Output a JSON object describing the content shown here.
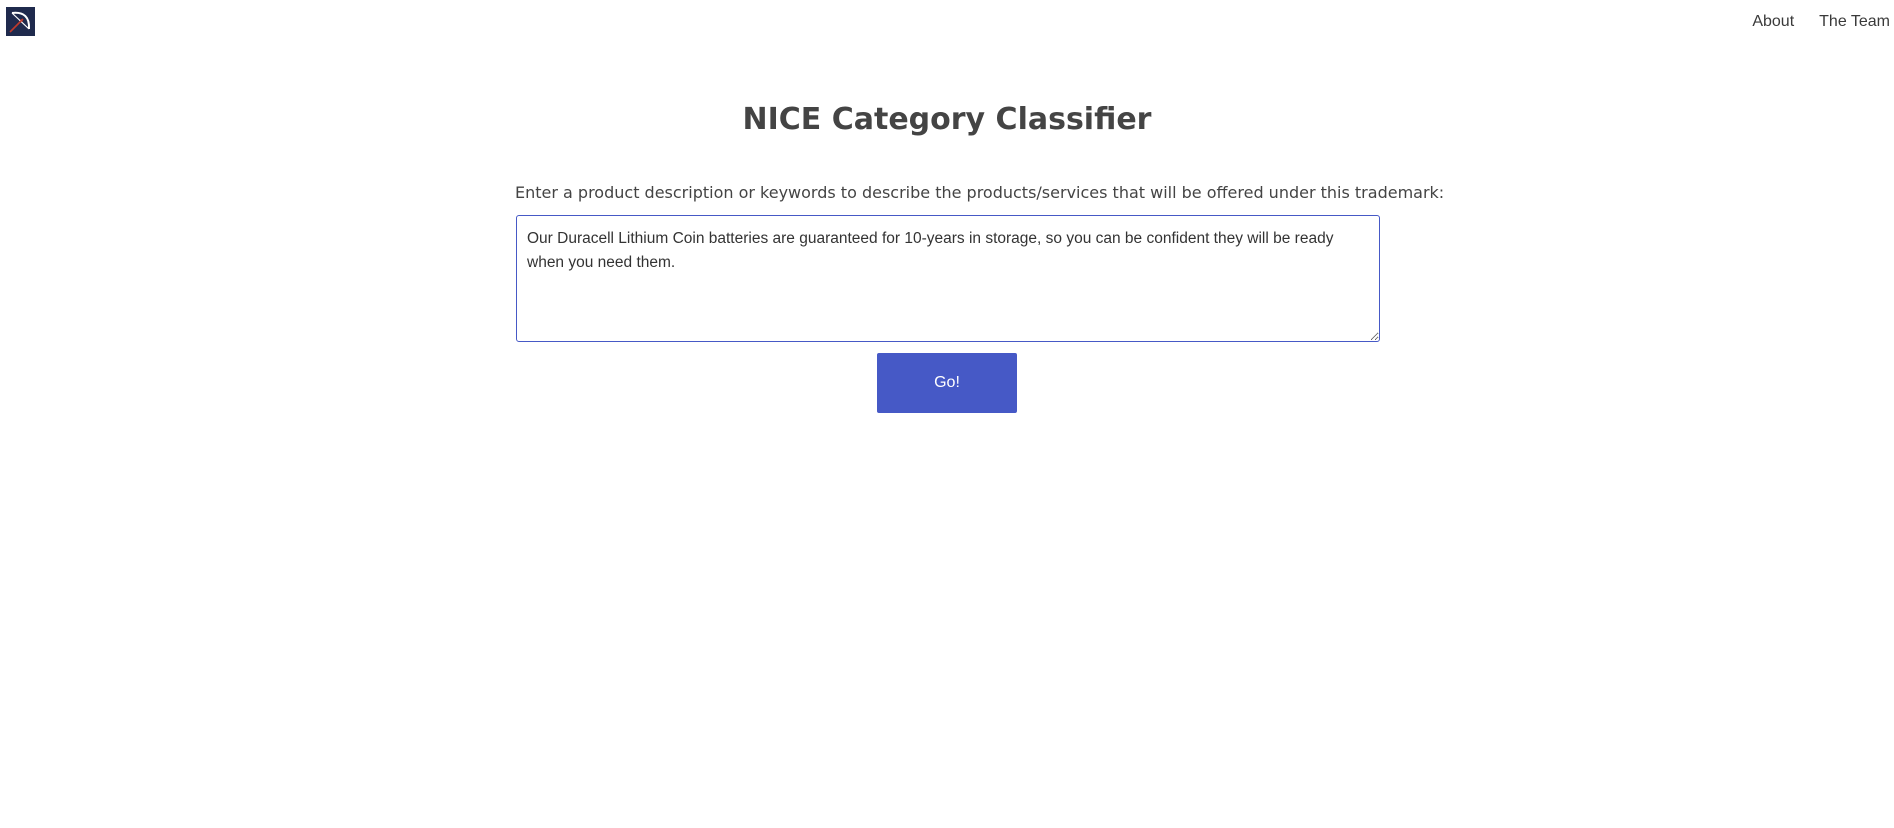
{
  "header": {
    "logo_icon": "bow-and-arrow-logo-icon",
    "nav": [
      {
        "label": "About"
      },
      {
        "label": "The Team"
      }
    ]
  },
  "main": {
    "title": "NICE Category Classifier",
    "prompt": "Enter a product description or keywords to describe the products/services that will be offered under this trademark:",
    "input_value": "Our Duracell Lithium Coin batteries are guaranteed for 10-years in storage, so you can be confident they will be ready when you need them.",
    "submit_label": "Go!"
  },
  "colors": {
    "accent": "#4659c6",
    "logo_bg": "#1f2a4d",
    "text": "#444444"
  }
}
